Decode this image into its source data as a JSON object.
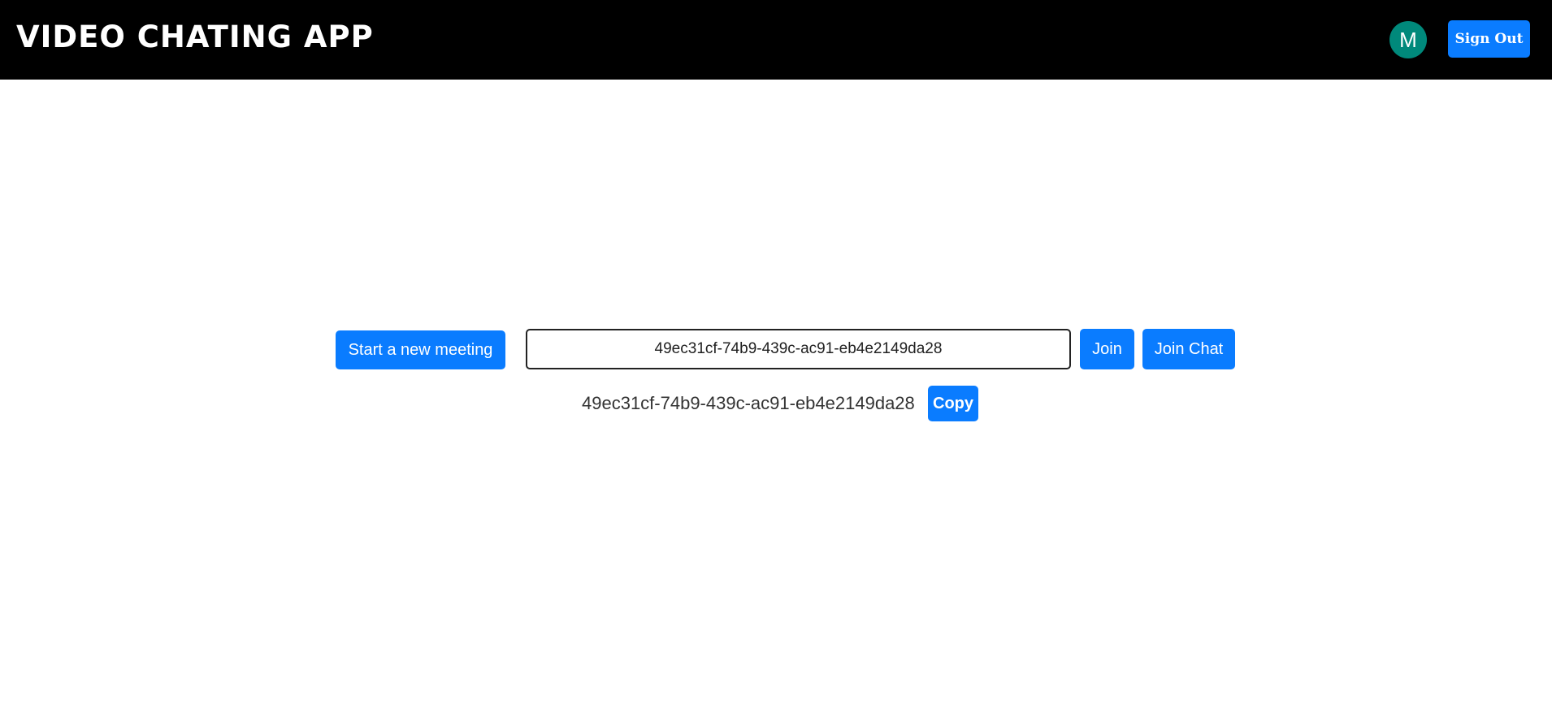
{
  "header": {
    "title": "VIDEO CHATING APP",
    "avatar_initial": "M",
    "sign_out_label": "Sign Out"
  },
  "meeting": {
    "start_label": "Start a new meeting",
    "meeting_id_value": "49ec31cf-74b9-439c-ac91-eb4e2149da28",
    "join_label": "Join",
    "join_chat_label": "Join Chat",
    "generated_id": "49ec31cf-74b9-439c-ac91-eb4e2149da28",
    "copy_label": "Copy"
  },
  "colors": {
    "header_bg": "#000000",
    "accent": "#0a7cff",
    "avatar_bg": "#00897b"
  },
  "icons": {
    "avatar": "user-avatar-initial"
  }
}
